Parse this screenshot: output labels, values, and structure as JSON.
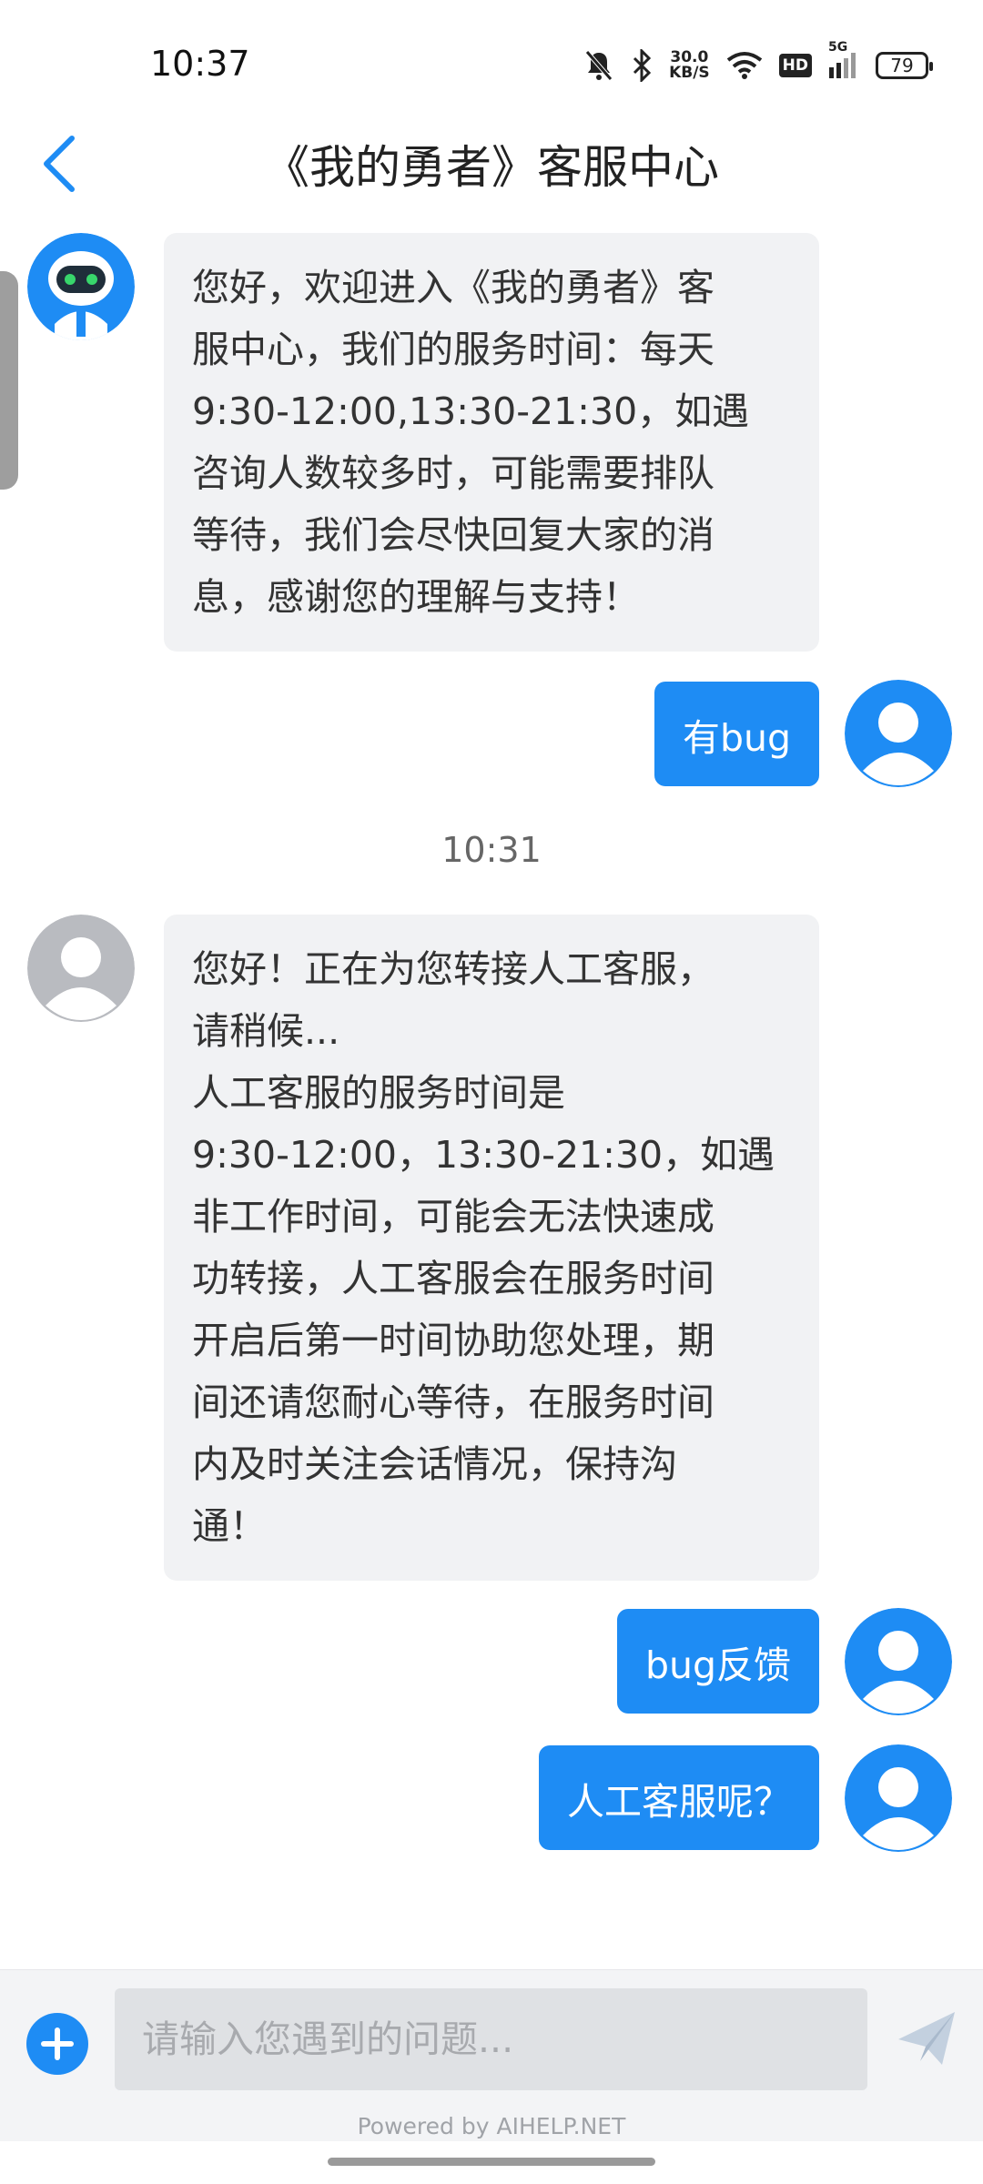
{
  "status_bar": {
    "time": "10:37",
    "net_speed_value": "30.0",
    "net_speed_unit": "KB/S",
    "hd_label": "HD",
    "signal_label": "5G",
    "battery": "79",
    "icons": [
      "mute-bell-icon",
      "bluetooth-icon",
      "wifi-icon",
      "signal-icon"
    ]
  },
  "header": {
    "title": "《我的勇者》客服中心",
    "back_icon": "chevron-left-icon"
  },
  "chat": {
    "messages": [
      {
        "side": "incoming",
        "avatar": "robot-avatar",
        "text": "您好，欢迎进入《我的勇者》客\n服中心，我们的服务时间：每天\n9:30-12:00,13:30-21:30，如遇\n咨询人数较多时，可能需要排队\n等待，我们会尽快回复大家的消\n息，感谢您的理解与支持！"
      },
      {
        "side": "outgoing",
        "avatar": "user-avatar",
        "text": "有bug"
      },
      {
        "type": "time",
        "text": "10:31"
      },
      {
        "side": "incoming",
        "avatar": "agent-avatar",
        "text": "您好！正在为您转接人工客服，\n请稍候...\n人工客服的服务时间是\n9:30-12:00，13:30-21:30，如遇\n非工作时间，可能会无法快速成\n功转接，人工客服会在服务时间\n开启后第一时间协助您处理，期\n间还请您耐心等待，在服务时间\n内及时关注会话情况，保持沟\n通！"
      },
      {
        "side": "outgoing",
        "avatar": "user-avatar",
        "text": "bug反馈"
      },
      {
        "side": "outgoing",
        "avatar": "user-avatar",
        "text": "人工客服呢？"
      }
    ]
  },
  "input_bar": {
    "placeholder": "请输入您遇到的问题...",
    "value": "",
    "add_icon": "plus-icon",
    "send_icon": "send-icon"
  },
  "footer": {
    "powered_by": "Powered by AIHELP.NET"
  },
  "colors": {
    "accent": "#1e8cf4",
    "incoming_bubble": "#f1f2f4",
    "input_bar_bg": "#f3f4f6"
  }
}
